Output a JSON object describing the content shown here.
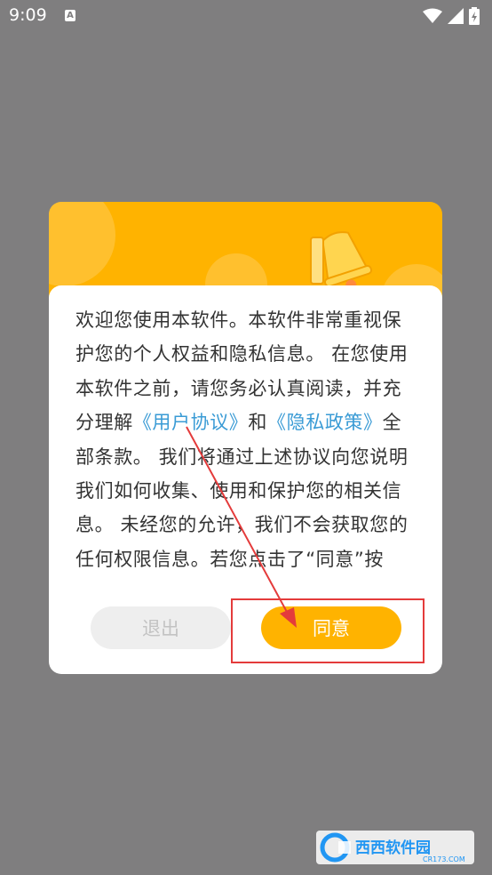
{
  "status_bar": {
    "time": "9:09",
    "notification_icon": "A",
    "icons": [
      "wifi-icon",
      "signal-icon",
      "battery-icon"
    ]
  },
  "dialog": {
    "header_icon": "bell-icon",
    "text_before_link1": "欢迎您使用本软件。本软件非常重视保护您的个人权益和隐私信息。 在您使用本软件之前，请您务必认真阅读，并充分理解",
    "link_user_agreement": "《用户协议》",
    "text_and": "和",
    "link_privacy_policy": "《隐私政策》",
    "text_after_links": "全部条款。 我们将通过上述协议向您说明我们如何收集、使用和保护您的相关信息。 未经您的允许，我们不会获取您的任何权限信息。若您点击了“同意”按钮，",
    "exit_button": "退出",
    "agree_button": "同意"
  },
  "colors": {
    "background": "#7f7e7f",
    "accent": "#ffb300",
    "link": "#3a9bd5",
    "annotation": "#e43b3b"
  },
  "watermark": {
    "brand": "西西软件园",
    "site": "CR173.COM"
  }
}
